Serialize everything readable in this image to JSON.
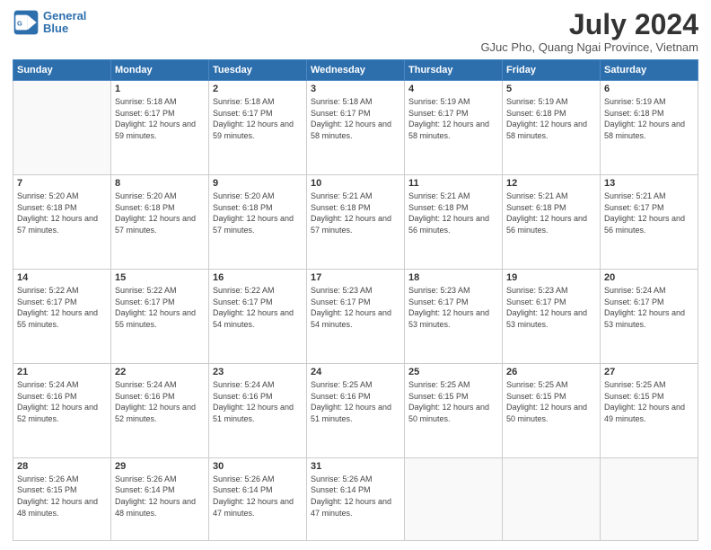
{
  "logo": {
    "line1": "General",
    "line2": "Blue"
  },
  "title": "July 2024",
  "subtitle": "GJuc Pho, Quang Ngai Province, Vietnam",
  "weekdays": [
    "Sunday",
    "Monday",
    "Tuesday",
    "Wednesday",
    "Thursday",
    "Friday",
    "Saturday"
  ],
  "weeks": [
    [
      {
        "day": "",
        "sunrise": "",
        "sunset": "",
        "daylight": ""
      },
      {
        "day": "1",
        "sunrise": "Sunrise: 5:18 AM",
        "sunset": "Sunset: 6:17 PM",
        "daylight": "Daylight: 12 hours and 59 minutes."
      },
      {
        "day": "2",
        "sunrise": "Sunrise: 5:18 AM",
        "sunset": "Sunset: 6:17 PM",
        "daylight": "Daylight: 12 hours and 59 minutes."
      },
      {
        "day": "3",
        "sunrise": "Sunrise: 5:18 AM",
        "sunset": "Sunset: 6:17 PM",
        "daylight": "Daylight: 12 hours and 58 minutes."
      },
      {
        "day": "4",
        "sunrise": "Sunrise: 5:19 AM",
        "sunset": "Sunset: 6:17 PM",
        "daylight": "Daylight: 12 hours and 58 minutes."
      },
      {
        "day": "5",
        "sunrise": "Sunrise: 5:19 AM",
        "sunset": "Sunset: 6:18 PM",
        "daylight": "Daylight: 12 hours and 58 minutes."
      },
      {
        "day": "6",
        "sunrise": "Sunrise: 5:19 AM",
        "sunset": "Sunset: 6:18 PM",
        "daylight": "Daylight: 12 hours and 58 minutes."
      }
    ],
    [
      {
        "day": "7",
        "sunrise": "Sunrise: 5:20 AM",
        "sunset": "Sunset: 6:18 PM",
        "daylight": "Daylight: 12 hours and 57 minutes."
      },
      {
        "day": "8",
        "sunrise": "Sunrise: 5:20 AM",
        "sunset": "Sunset: 6:18 PM",
        "daylight": "Daylight: 12 hours and 57 minutes."
      },
      {
        "day": "9",
        "sunrise": "Sunrise: 5:20 AM",
        "sunset": "Sunset: 6:18 PM",
        "daylight": "Daylight: 12 hours and 57 minutes."
      },
      {
        "day": "10",
        "sunrise": "Sunrise: 5:21 AM",
        "sunset": "Sunset: 6:18 PM",
        "daylight": "Daylight: 12 hours and 57 minutes."
      },
      {
        "day": "11",
        "sunrise": "Sunrise: 5:21 AM",
        "sunset": "Sunset: 6:18 PM",
        "daylight": "Daylight: 12 hours and 56 minutes."
      },
      {
        "day": "12",
        "sunrise": "Sunrise: 5:21 AM",
        "sunset": "Sunset: 6:18 PM",
        "daylight": "Daylight: 12 hours and 56 minutes."
      },
      {
        "day": "13",
        "sunrise": "Sunrise: 5:21 AM",
        "sunset": "Sunset: 6:17 PM",
        "daylight": "Daylight: 12 hours and 56 minutes."
      }
    ],
    [
      {
        "day": "14",
        "sunrise": "Sunrise: 5:22 AM",
        "sunset": "Sunset: 6:17 PM",
        "daylight": "Daylight: 12 hours and 55 minutes."
      },
      {
        "day": "15",
        "sunrise": "Sunrise: 5:22 AM",
        "sunset": "Sunset: 6:17 PM",
        "daylight": "Daylight: 12 hours and 55 minutes."
      },
      {
        "day": "16",
        "sunrise": "Sunrise: 5:22 AM",
        "sunset": "Sunset: 6:17 PM",
        "daylight": "Daylight: 12 hours and 54 minutes."
      },
      {
        "day": "17",
        "sunrise": "Sunrise: 5:23 AM",
        "sunset": "Sunset: 6:17 PM",
        "daylight": "Daylight: 12 hours and 54 minutes."
      },
      {
        "day": "18",
        "sunrise": "Sunrise: 5:23 AM",
        "sunset": "Sunset: 6:17 PM",
        "daylight": "Daylight: 12 hours and 53 minutes."
      },
      {
        "day": "19",
        "sunrise": "Sunrise: 5:23 AM",
        "sunset": "Sunset: 6:17 PM",
        "daylight": "Daylight: 12 hours and 53 minutes."
      },
      {
        "day": "20",
        "sunrise": "Sunrise: 5:24 AM",
        "sunset": "Sunset: 6:17 PM",
        "daylight": "Daylight: 12 hours and 53 minutes."
      }
    ],
    [
      {
        "day": "21",
        "sunrise": "Sunrise: 5:24 AM",
        "sunset": "Sunset: 6:16 PM",
        "daylight": "Daylight: 12 hours and 52 minutes."
      },
      {
        "day": "22",
        "sunrise": "Sunrise: 5:24 AM",
        "sunset": "Sunset: 6:16 PM",
        "daylight": "Daylight: 12 hours and 52 minutes."
      },
      {
        "day": "23",
        "sunrise": "Sunrise: 5:24 AM",
        "sunset": "Sunset: 6:16 PM",
        "daylight": "Daylight: 12 hours and 51 minutes."
      },
      {
        "day": "24",
        "sunrise": "Sunrise: 5:25 AM",
        "sunset": "Sunset: 6:16 PM",
        "daylight": "Daylight: 12 hours and 51 minutes."
      },
      {
        "day": "25",
        "sunrise": "Sunrise: 5:25 AM",
        "sunset": "Sunset: 6:15 PM",
        "daylight": "Daylight: 12 hours and 50 minutes."
      },
      {
        "day": "26",
        "sunrise": "Sunrise: 5:25 AM",
        "sunset": "Sunset: 6:15 PM",
        "daylight": "Daylight: 12 hours and 50 minutes."
      },
      {
        "day": "27",
        "sunrise": "Sunrise: 5:25 AM",
        "sunset": "Sunset: 6:15 PM",
        "daylight": "Daylight: 12 hours and 49 minutes."
      }
    ],
    [
      {
        "day": "28",
        "sunrise": "Sunrise: 5:26 AM",
        "sunset": "Sunset: 6:15 PM",
        "daylight": "Daylight: 12 hours and 48 minutes."
      },
      {
        "day": "29",
        "sunrise": "Sunrise: 5:26 AM",
        "sunset": "Sunset: 6:14 PM",
        "daylight": "Daylight: 12 hours and 48 minutes."
      },
      {
        "day": "30",
        "sunrise": "Sunrise: 5:26 AM",
        "sunset": "Sunset: 6:14 PM",
        "daylight": "Daylight: 12 hours and 47 minutes."
      },
      {
        "day": "31",
        "sunrise": "Sunrise: 5:26 AM",
        "sunset": "Sunset: 6:14 PM",
        "daylight": "Daylight: 12 hours and 47 minutes."
      },
      {
        "day": "",
        "sunrise": "",
        "sunset": "",
        "daylight": ""
      },
      {
        "day": "",
        "sunrise": "",
        "sunset": "",
        "daylight": ""
      },
      {
        "day": "",
        "sunrise": "",
        "sunset": "",
        "daylight": ""
      }
    ]
  ]
}
